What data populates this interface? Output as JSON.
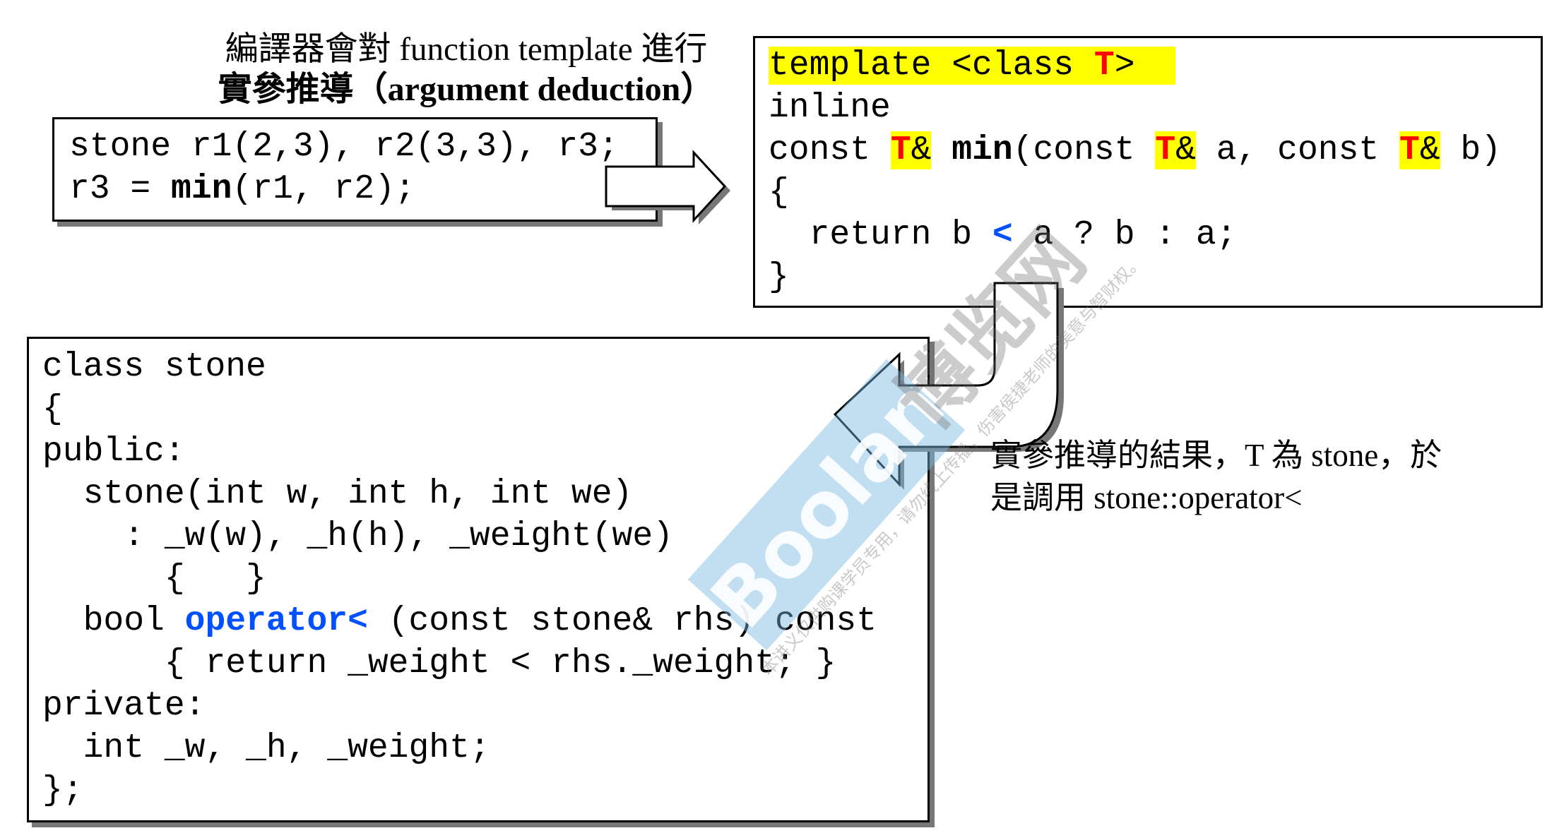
{
  "title": {
    "line1": "編譯器會對 function template 進行",
    "line2": "實參推導（argument deduction）"
  },
  "call_box": {
    "lines": [
      [
        {
          "t": "stone r1(2,3), r2(3,3), r3;"
        }
      ],
      [
        {
          "t": "r3 = "
        },
        {
          "t": "min",
          "s": "b"
        },
        {
          "t": "(r1, r2);"
        }
      ]
    ]
  },
  "template_box": {
    "lines": [
      [
        {
          "t": "template <class ",
          "s": "hl"
        },
        {
          "t": "T",
          "s": "hl red"
        },
        {
          "t": ">  ",
          "s": "hl"
        }
      ],
      [
        {
          "t": "inline"
        }
      ],
      [
        {
          "t": "const "
        },
        {
          "t": "T",
          "s": "hl red"
        },
        {
          "t": "&",
          "s": "hl"
        },
        {
          "t": " "
        },
        {
          "t": "min",
          "s": "b"
        },
        {
          "t": "(const "
        },
        {
          "t": "T",
          "s": "hl red"
        },
        {
          "t": "&",
          "s": "hl"
        },
        {
          "t": " a, const "
        },
        {
          "t": "T",
          "s": "hl red"
        },
        {
          "t": "&",
          "s": "hl"
        },
        {
          "t": " b)"
        }
      ],
      [
        {
          "t": "{"
        }
      ],
      [
        {
          "t": "  return b "
        },
        {
          "t": "<",
          "s": "blue"
        },
        {
          "t": " a ? b : a;"
        }
      ],
      [
        {
          "t": "}"
        }
      ]
    ]
  },
  "class_box": {
    "lines": [
      [
        {
          "t": "class stone"
        }
      ],
      [
        {
          "t": "{"
        }
      ],
      [
        {
          "t": "public:"
        }
      ],
      [
        {
          "t": "  stone(int w, int h, int we)"
        }
      ],
      [
        {
          "t": "    : _w(w), _h(h), _weight(we)"
        }
      ],
      [
        {
          "t": "      {   }"
        }
      ],
      [
        {
          "t": "  bool "
        },
        {
          "t": "operator<",
          "s": "blue"
        },
        {
          "t": " (const stone& rhs) const"
        }
      ],
      [
        {
          "t": "      { return _weight < rhs._weight; }"
        }
      ],
      [
        {
          "t": "private:"
        }
      ],
      [
        {
          "t": "  int _w, _h, _weight;"
        }
      ],
      [
        {
          "t": "};"
        }
      ]
    ]
  },
  "note": {
    "line1": "實參推導的結果，T 為 stone，於",
    "line2": "是調用 stone::operator<"
  },
  "watermark": {
    "logo": "Boolan",
    "site": "博览网",
    "notice": "本讲义仅供购课学员专用，请勿线上传播，伤害侯捷老师的美意与智财权。"
  },
  "colors": {
    "highlight": "#ffff00",
    "type_param": "#ff0000",
    "operator": "#0050ff"
  }
}
